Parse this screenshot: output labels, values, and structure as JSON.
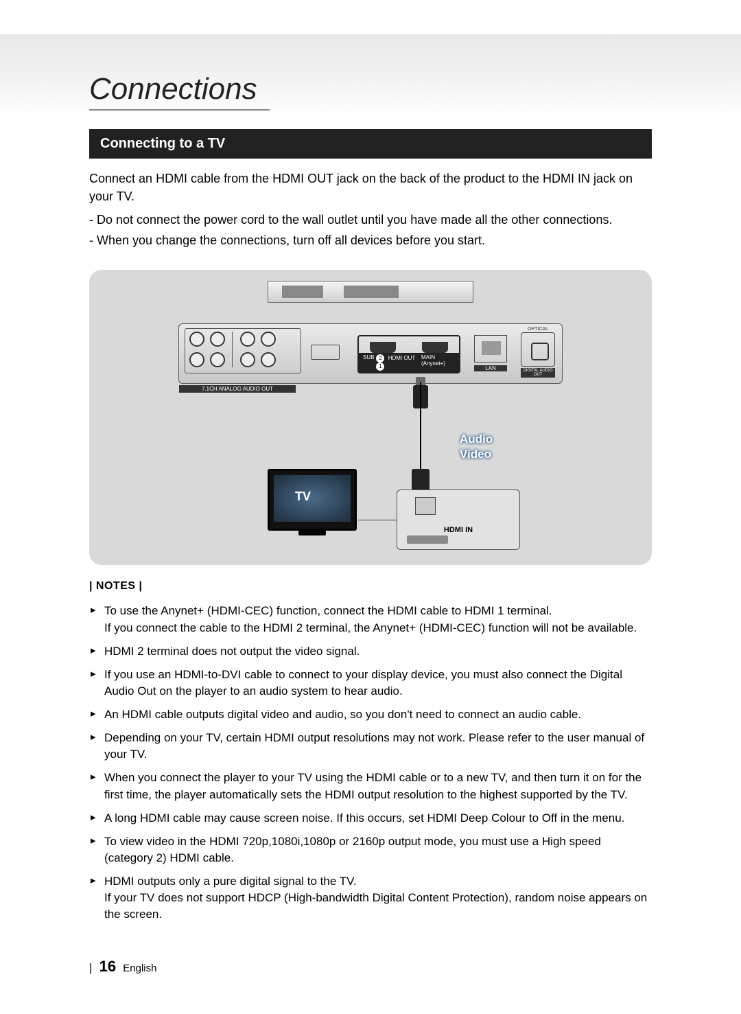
{
  "section_title": "Connections",
  "sub_header": "Connecting to a TV",
  "intro": "Connect an HDMI cable from the HDMI OUT jack on the back of the product to the HDMI IN jack on your TV.",
  "intro_items": [
    "-  Do not connect the power cord to the wall outlet until you have made all the other connections.",
    "-  When you change the connections, turn off all devices before you start."
  ],
  "diagram": {
    "analog_label": "7.1CH ANALOG AUDIO OUT",
    "hdmi_out_label": "HDMI OUT",
    "hdmi_sub_label": "SUB",
    "hdmi_main_label": "MAIN (Anynet+)",
    "lan_label": "LAN",
    "optical_label": "OPTICAL",
    "digital_audio_label": "DIGITAL AUDIO OUT",
    "cable_label_audio": "Audio",
    "cable_label_video": "Video",
    "hdmi_in_label": "HDMI IN",
    "tv_label": "TV",
    "hdmi_port_1": "2",
    "hdmi_port_2": "1"
  },
  "notes_title": "| NOTES |",
  "notes": [
    "To use the Anynet+ (HDMI-CEC) function, connect the HDMI cable to HDMI 1 terminal.\nIf you connect the cable to the HDMI 2 terminal, the Anynet+ (HDMI-CEC) function will not be available.",
    "HDMI 2 terminal does not output the video signal.",
    "If you use an HDMI-to-DVI cable to connect to your display device, you must also connect the Digital Audio Out on the player to an audio system to hear audio.",
    "An HDMI cable outputs digital video and audio, so you don't need to connect an audio cable.",
    "Depending on your TV, certain HDMI output resolutions may not work. Please refer to the user manual of your TV.",
    "When you connect the player to your TV using the HDMI cable or to a new TV, and then turn it on for the first time, the player automatically sets the HDMI output resolution to the highest supported by the TV.",
    "A long HDMI cable may cause screen noise. If this occurs, set HDMI Deep Colour to Off in the menu.",
    "To view video in the HDMI 720p,1080i,1080p or 2160p output mode, you must use a High speed (category 2) HDMI cable.",
    "HDMI outputs only a pure digital signal to the TV.\nIf your TV does not support HDCP (High-bandwidth Digital Content Protection), random noise appears on the screen."
  ],
  "footer": {
    "page_number": "16",
    "language": "English"
  }
}
